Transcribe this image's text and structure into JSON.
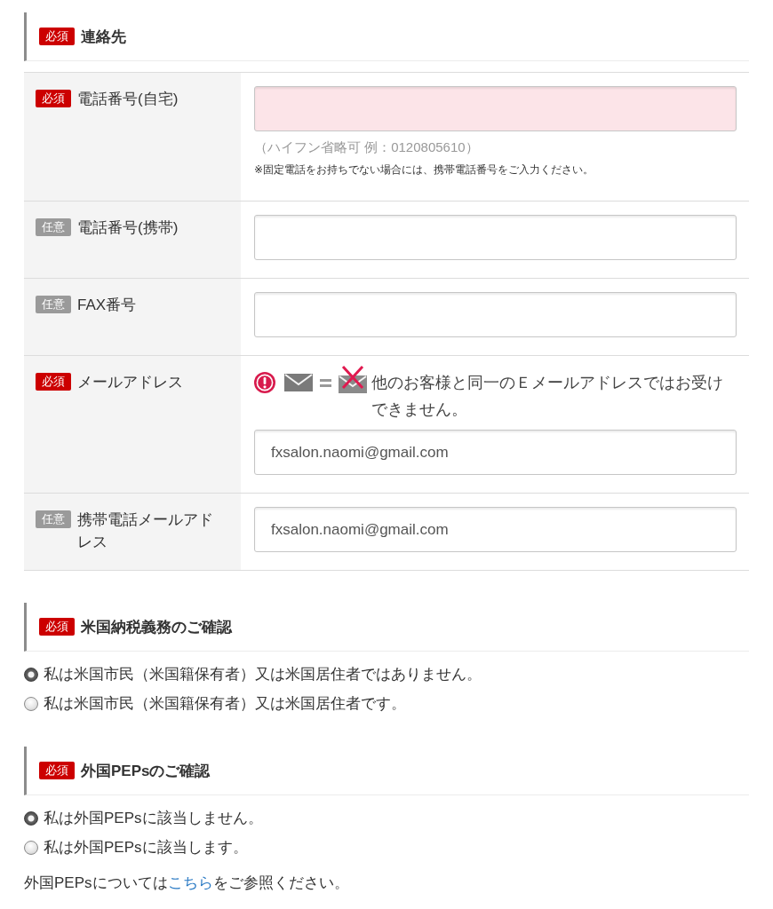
{
  "contact": {
    "badge": {
      "label": "必須",
      "kind": "required"
    },
    "title": "連絡先",
    "rows": [
      {
        "badge": {
          "label": "必須",
          "kind": "required"
        },
        "label": "電話番号(自宅)",
        "field": {
          "invalid": true
        },
        "hint": "（ハイフン省略可 例：0120805610）",
        "note": "※固定電話をお持ちでない場合には、携帯電話番号をご入力ください。"
      },
      {
        "badge": {
          "label": "任意",
          "kind": "optional"
        },
        "label": "電話番号(携帯)",
        "field": {
          "invalid": false
        }
      },
      {
        "badge": {
          "label": "任意",
          "kind": "optional"
        },
        "label": "FAX番号",
        "field": {
          "invalid": false
        }
      },
      {
        "badge": {
          "label": "必須",
          "kind": "required"
        },
        "label": "メールアドレス",
        "notice": "他のお客様と同一のＥメールアドレスではお受けできません。",
        "field": {
          "invalid": false,
          "value": "fxsalon.naomi@gmail.com"
        }
      },
      {
        "badge": {
          "label": "任意",
          "kind": "optional"
        },
        "label": "携帯電話メールアドレス",
        "field": {
          "invalid": false,
          "value": "fxsalon.naomi@gmail.com"
        }
      }
    ]
  },
  "us_tax": {
    "badge": {
      "label": "必須",
      "kind": "required"
    },
    "title": "米国納税義務のご確認",
    "options": [
      {
        "label": "私は米国市民（米国籍保有者）又は米国居住者ではありません。",
        "selected": true
      },
      {
        "label": "私は米国市民（米国籍保有者）又は米国居住者です。",
        "selected": false
      }
    ]
  },
  "peps": {
    "badge": {
      "label": "必須",
      "kind": "required"
    },
    "title": "外国PEPsのご確認",
    "options": [
      {
        "label": "私は外国PEPsに該当しません。",
        "selected": true
      },
      {
        "label": "私は外国PEPsに該当します。",
        "selected": false
      }
    ],
    "footnote": {
      "before": "外国PEPsについては",
      "link": "こちら",
      "after": "をご参照ください。"
    }
  }
}
